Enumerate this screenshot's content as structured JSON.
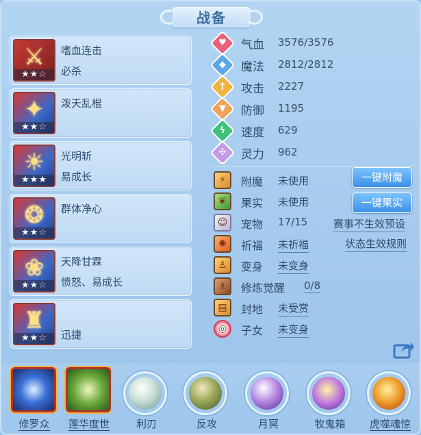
{
  "title": "战备",
  "skills": [
    {
      "name": "嗜血连击",
      "desc": "必杀",
      "stars_on": "★★",
      "stars_off": "☆",
      "glyph": "⚔"
    },
    {
      "name": "泼天乱棍",
      "desc": "",
      "stars_on": "★★",
      "stars_off": "☆",
      "glyph": "✦"
    },
    {
      "name": "光明斩",
      "desc": "易成长",
      "stars_on": "★★★",
      "stars_off": "",
      "glyph": "☀"
    },
    {
      "name": "群体净心",
      "desc": "",
      "stars_on": "★★",
      "stars_off": "☆",
      "glyph": "❂"
    },
    {
      "name": "天降甘霖",
      "desc": "愤怒、易成长",
      "stars_on": "★★",
      "stars_off": "☆",
      "glyph": "❀"
    },
    {
      "name": "",
      "desc": "迅捷",
      "stars_on": "★★",
      "stars_off": "☆",
      "glyph": "♜"
    }
  ],
  "stats": [
    {
      "label": "气血",
      "value": "3576/3576",
      "icon": "heart-icon",
      "glyph": "♥",
      "color": "#e8607a"
    },
    {
      "label": "魔法",
      "value": "2812/2812",
      "icon": "mana-icon",
      "glyph": "◆",
      "color": "#5aa8ea"
    },
    {
      "label": "攻击",
      "value": "2227",
      "icon": "sword-icon",
      "glyph": "†",
      "color": "#f0b43a"
    },
    {
      "label": "防御",
      "value": "1195",
      "icon": "shield-icon",
      "glyph": "▼",
      "color": "#f0a15a"
    },
    {
      "label": "速度",
      "value": "629",
      "icon": "speed-icon",
      "glyph": "ϟ",
      "color": "#3cc27a"
    },
    {
      "label": "灵力",
      "value": "962",
      "icon": "spirit-icon",
      "glyph": "✣",
      "color": "#c79ae8"
    }
  ],
  "attachments": [
    {
      "label": "附魔",
      "value": "未使用",
      "icon": "enchant-icon",
      "glyph": "⚡",
      "underline": false
    },
    {
      "label": "果实",
      "value": "未使用",
      "icon": "fruit-icon",
      "glyph": "❦",
      "underline": false
    },
    {
      "label": "宠物",
      "value": "17/15",
      "icon": "pet-icon",
      "glyph": "☺",
      "underline": false
    },
    {
      "label": "祈福",
      "value": "未祈福",
      "icon": "blessing-icon",
      "glyph": "✺",
      "underline": true
    },
    {
      "label": "变身",
      "value": "未变身",
      "icon": "transform-icon",
      "glyph": "♙",
      "underline": true
    },
    {
      "label": "修炼觉醒",
      "value": "0/8",
      "icon": "cultivate-icon",
      "glyph": "♗",
      "underline": true
    },
    {
      "label": "封地",
      "value": "未受赏",
      "icon": "fief-icon",
      "glyph": "▤",
      "underline": true
    },
    {
      "label": "子女",
      "value": "未变身",
      "icon": "child-icon",
      "glyph": "◎",
      "underline": true
    }
  ],
  "buttons": {
    "enchant": "一键附魔",
    "fruit": "一键果实"
  },
  "links": {
    "event_preset": "赛事不生效预设",
    "status_rules": "状态生效规则"
  },
  "bottom": [
    {
      "label": "修罗众",
      "kind": "square",
      "underline": true,
      "color": "#3a6fd8"
    },
    {
      "label": "莲华度世",
      "kind": "square",
      "underline": true,
      "color": "#6aa83a"
    },
    {
      "label": "利刃",
      "kind": "orb",
      "underline": false,
      "color": "#cfe3d8"
    },
    {
      "label": "反攻",
      "kind": "orb",
      "underline": false,
      "color": "#9aa85a"
    },
    {
      "label": "月冥",
      "kind": "orb",
      "underline": false,
      "color": "#b78ae6"
    },
    {
      "label": "牧鬼箱",
      "kind": "orb",
      "underline": false,
      "color": "#c07ae0"
    },
    {
      "label": "虎噬魂惊",
      "kind": "orb",
      "underline": true,
      "color": "#f0a030"
    }
  ]
}
